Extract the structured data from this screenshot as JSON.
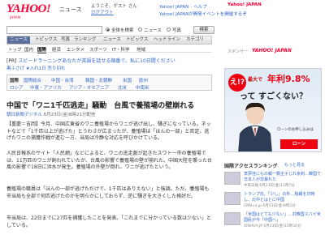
{
  "header": {
    "logo": "YAHOO!",
    "logo_sub": "JAPAN",
    "section": "ニュース",
    "greeting": "ようこそ、ゲスト さん",
    "login": "ログアウト",
    "toplinks": [
      "Yahoo! JAPAN",
      "ヘルプ"
    ],
    "notice": "Yahoo! JAPANが開発イベントを開催するぞ"
  },
  "right_header": {
    "logo": "Yahoo! JAPAN",
    "promo": "Yahoo! JAPAN"
  },
  "search": {
    "value": "",
    "placeholder": "",
    "options": [
      "全体を検索",
      "ニュース",
      "写真"
    ],
    "button": "検索"
  },
  "nav": {
    "items": [
      "ニュース",
      "トピックス",
      "写真",
      "ランキング",
      "ニュース",
      "トピックス",
      "ヘッドライン",
      "カテゴリ"
    ],
    "active_index": 0
  },
  "subnav": {
    "items": [
      "トップ",
      "国内",
      "国際",
      "経済",
      "エンタメ",
      "スポーツ",
      "IT・科学",
      "地域"
    ],
    "active_index": 2
  },
  "pr": {
    "tag": "[PR]",
    "text": "スピードラーニングあなたが英語を話せる順番で、私に10日間ください"
  },
  "ads_row": "黒ふさげ ★入れ1日 売り切れ",
  "sponsor": {
    "label": "スポンサー",
    "brand": "YAHOO! JAPAN"
  },
  "regions": {
    "row1": [
      "国際",
      "国際総合",
      "中国・台湾",
      "韓国・北朝鮮",
      "米国",
      "欧州"
    ],
    "row2": [
      "ロシア",
      "中東・アフリカ",
      "アジア・オセアニア",
      "北米",
      "中南米"
    ],
    "row3": [
      "中東・アフリカ"
    ]
  },
  "ad": {
    "bubble": "え!?",
    "line1": "最大で",
    "rate": "年利9.8%",
    "line2": "って すごくない？",
    "sub": "ローンのお申し込みは",
    "brand": "ローン"
  },
  "article": {
    "headline": "中国で「ワニ1千匹逃走」騒動　台風で養殖場の壁崩れる",
    "source": "朝日新聞デジタル",
    "date": "6月23日(金)8時21分配信",
    "paragraphs": [
      "【重慶＝吉岡】今月、中国広東省のワニ養殖場からワニが逃げ出し、騒ぎになっている。ネットなどで「1千匹以上が逃げた」とうわさが広まったが、養殖場は「ほんの一部」と否定。逃げたワニの捕獲作戦が進む一方、当局は冷静な対応を呼びかけている。",
      "人民日報系のサイト「人民網」などによると、ワニの逃走劇が起きたスワトー市の養殖場では、11万匹のワニが飼われていたが、台風の影響で養殖場の壁が崩れた。中国大陸を襲った台風の影響で18日に洪水が発生。養殖場の外壁が倒れ、ワニが逃げたという。",
      "養殖場の職員は「ほんの一部が逃げただけで、1千匹はありえない」と強調。ただ、養殖場も市当局も全部で何匹逃げたのかを明らかにしておらず、逆に騒ぎを大きくした格好だ。",
      "市当局は、22日までに27匹を捕獲したことを発表。「これまでに分かっている数は少ない」としている。"
    ]
  },
  "related": {
    "title": "国際アクセスランキング",
    "more": "もっと見る",
    "items": [
      {
        "text": "李夢佳にもの報一類主子じれ余剣…韓国で日本人が非暴れた",
        "meta": "中央日報 6月23日(金)11時7分"
      },
      {
        "text": "トランプ氏、「少し」の朴…独報を対時し、北中とはとに中国",
        "meta": "CNN.co.jp 6月23日(金)9時2分"
      },
      {
        "text": "「米国はとても少ない」…対韓国スパイ米国民が今「中国へ」",
        "meta": "XINHUA.JP 6月23日(金)15時32分"
      }
    ]
  }
}
